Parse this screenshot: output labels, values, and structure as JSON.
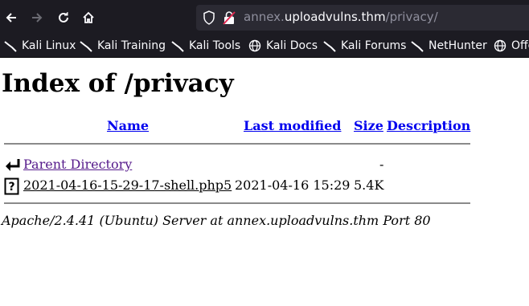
{
  "browser": {
    "url_host": "annex.",
    "url_domain": "uploadvulns.thm",
    "url_path": "/privacy/",
    "bookmarks": [
      {
        "label": "Kali Linux",
        "icon": "kali-dragon-icon"
      },
      {
        "label": "Kali Training",
        "icon": "kali-dragon-icon"
      },
      {
        "label": "Kali Tools",
        "icon": "kali-dragon-icon"
      },
      {
        "label": "Kali Docs",
        "icon": "globe-icon"
      },
      {
        "label": "Kali Forums",
        "icon": "kali-dragon-icon"
      },
      {
        "label": "NetHunter",
        "icon": "kali-dragon-icon"
      },
      {
        "label": "Offe",
        "icon": "globe-icon"
      }
    ]
  },
  "page": {
    "title": "Index of /privacy",
    "columns": [
      "Name",
      "Last modified",
      "Size",
      "Description"
    ],
    "rows": [
      {
        "icon": "back-icon",
        "name": "Parent Directory",
        "modified": "",
        "size": "-",
        "description": ""
      },
      {
        "icon": "unknown-file-icon",
        "name": "2021-04-16-15-29-17-shell.php5",
        "modified": "2021-04-16 15:29",
        "size": "5.4K",
        "description": ""
      }
    ],
    "footer": "Apache/2.4.41 (Ubuntu) Server at annex.uploadvulns.thm Port 80"
  }
}
